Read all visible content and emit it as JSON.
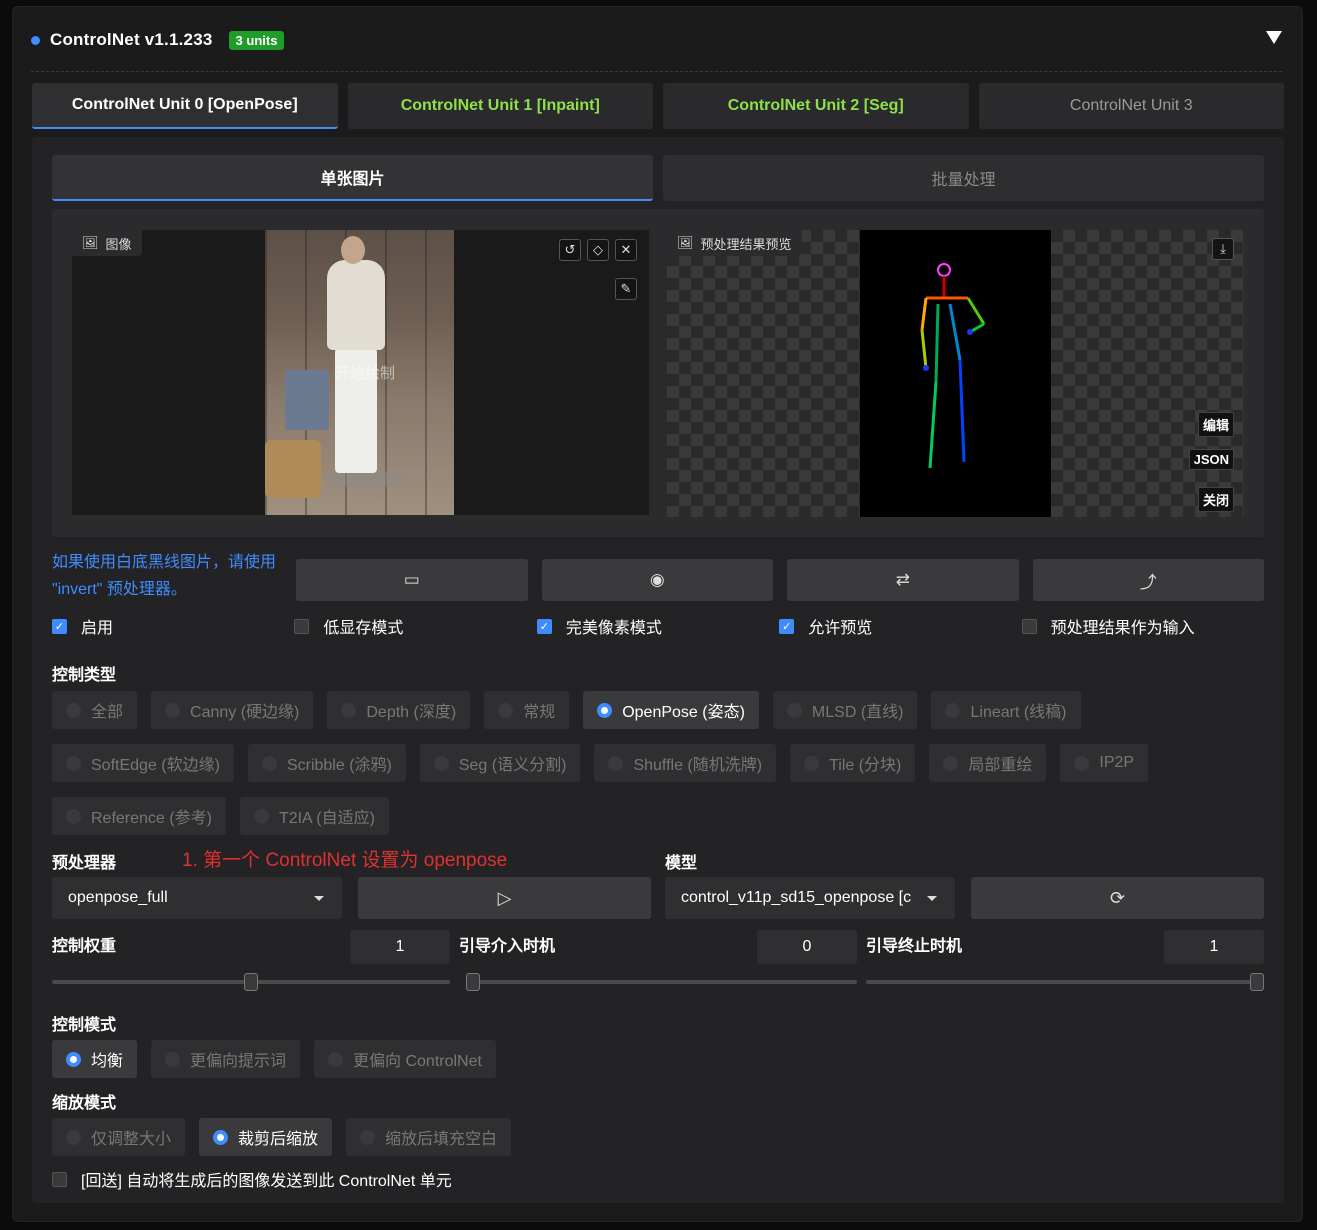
{
  "header": {
    "title": "ControlNet v1.1.233",
    "badge": "3 units"
  },
  "unit_tabs": [
    {
      "label": "ControlNet Unit 0 [OpenPose]",
      "state": "active"
    },
    {
      "label": "ControlNet Unit 1 [Inpaint]",
      "state": "enabled"
    },
    {
      "label": "ControlNet Unit 2 [Seg]",
      "state": "enabled"
    },
    {
      "label": "ControlNet Unit 3",
      "state": "idle"
    }
  ],
  "sub_tabs": [
    {
      "label": "单张图片",
      "active": true
    },
    {
      "label": "批量处理",
      "active": false
    }
  ],
  "image_panel": {
    "label": "图像",
    "watermark": "开始绘制"
  },
  "preview_panel": {
    "label": "预处理结果预览",
    "buttons": [
      "编辑",
      "JSON",
      "关闭"
    ]
  },
  "hint_text": "如果使用白底黑线图片，请使用 \"invert\" 预处理器。",
  "options": [
    {
      "label": "启用",
      "checked": true
    },
    {
      "label": "低显存模式",
      "checked": false
    },
    {
      "label": "完美像素模式",
      "checked": true
    },
    {
      "label": "允许预览",
      "checked": true
    },
    {
      "label": "预处理结果作为输入",
      "checked": false
    }
  ],
  "control_type": {
    "title": "控制类型",
    "options": [
      {
        "label": "全部",
        "selected": false
      },
      {
        "label": "Canny (硬边缘)",
        "selected": false
      },
      {
        "label": "Depth (深度)",
        "selected": false
      },
      {
        "label": "常规",
        "selected": false
      },
      {
        "label": "OpenPose (姿态)",
        "selected": true
      },
      {
        "label": "MLSD (直线)",
        "selected": false
      },
      {
        "label": "Lineart (线稿)",
        "selected": false
      },
      {
        "label": "SoftEdge (软边缘)",
        "selected": false
      },
      {
        "label": "Scribble (涂鸦)",
        "selected": false
      },
      {
        "label": "Seg (语义分割)",
        "selected": false
      },
      {
        "label": "Shuffle (随机洗牌)",
        "selected": false
      },
      {
        "label": "Tile (分块)",
        "selected": false
      },
      {
        "label": "局部重绘",
        "selected": false
      },
      {
        "label": "IP2P",
        "selected": false
      },
      {
        "label": "Reference (参考)",
        "selected": false
      },
      {
        "label": "T2IA (自适应)",
        "selected": false
      }
    ]
  },
  "preprocessor": {
    "title": "预处理器",
    "value": "openpose_full",
    "annotation": "1. 第一个 ControlNet 设置为 openpose"
  },
  "model": {
    "title": "模型",
    "value": "control_v11p_sd15_openpose [c"
  },
  "sliders": {
    "weight": {
      "label": "控制权重",
      "value": "1",
      "fraction": 0.5
    },
    "start": {
      "label": "引导介入时机",
      "value": "0",
      "fraction": 0.0
    },
    "end": {
      "label": "引导终止时机",
      "value": "1",
      "fraction": 1.0
    }
  },
  "control_mode": {
    "title": "控制模式",
    "options": [
      {
        "label": "均衡",
        "selected": true
      },
      {
        "label": "更偏向提示词",
        "selected": false
      },
      {
        "label": "更偏向 ControlNet",
        "selected": false
      }
    ]
  },
  "resize_mode": {
    "title": "缩放模式",
    "options": [
      {
        "label": "仅调整大小",
        "selected": false
      },
      {
        "label": "裁剪后缩放",
        "selected": true
      },
      {
        "label": "缩放后填充空白",
        "selected": false
      }
    ]
  },
  "loopback": {
    "label": "[回送] 自动将生成后的图像发送到此 ControlNet 单元",
    "checked": false
  },
  "colors": {
    "accent": "#3f8cff",
    "badge": "#1f9d28",
    "enabled_tab": "#8de04a",
    "annotation": "#e03030"
  }
}
